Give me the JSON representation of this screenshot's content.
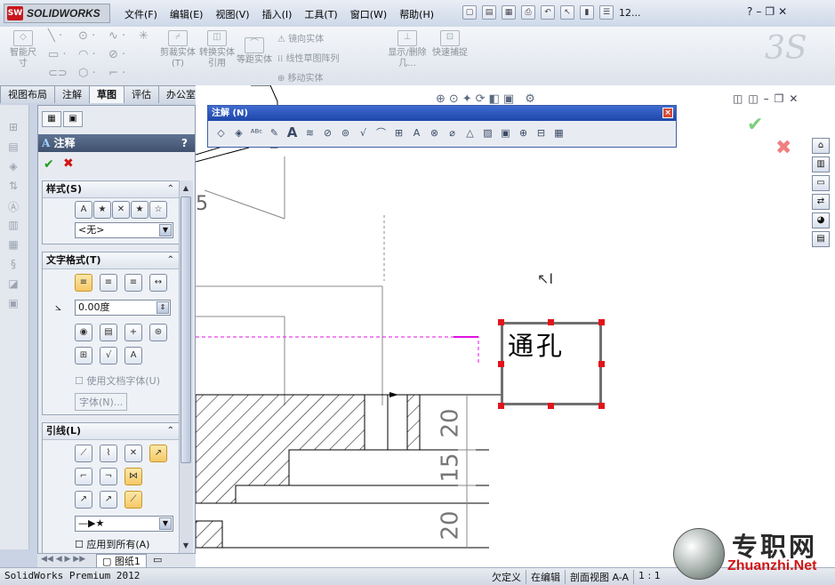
{
  "app": {
    "name": "SOLIDWORKS",
    "logo_mark": "SW",
    "title_suffix": "12...",
    "help": "?"
  },
  "menu": [
    "文件(F)",
    "编辑(E)",
    "视图(V)",
    "插入(I)",
    "工具(T)",
    "窗口(W)",
    "帮助(H)"
  ],
  "command_manager": {
    "smart_dim": "智能尺寸",
    "trim": "剪裁实体(T)",
    "convert": "转换实体引用",
    "offset": "等距实体",
    "mirror": "镜向实体",
    "linear_pattern": "线性草图阵列",
    "move": "移动实体",
    "show_hide": "显示/删除几...",
    "quick_snap": "快速捕捉"
  },
  "tabs": [
    "视图布局",
    "注解",
    "草图",
    "评估",
    "办公室产品"
  ],
  "active_tab": "草图",
  "property_manager": {
    "title": "注释",
    "help": "?",
    "style": {
      "header": "样式(S)",
      "value": "<无>"
    },
    "text_format": {
      "header": "文字格式(T)",
      "angle": "0.00度",
      "use_doc_font": "使用文档字体(U)",
      "font_button": "字体(N)..."
    },
    "leader": {
      "header": "引线(L)",
      "apply_all": "应用到所有(A)"
    }
  },
  "sheet_tab": "图纸1",
  "annotation_toolbar": {
    "title": "注解 (N)",
    "close": "×"
  },
  "note": {
    "text": "通孔"
  },
  "dimensions": [
    "20",
    "15",
    "20"
  ],
  "status": {
    "edition": "SolidWorks Premium 2012",
    "state": "欠定义",
    "editing": "在编辑",
    "view": "剖面视图 A-A",
    "scale": "1 : 1"
  },
  "watermark": {
    "cn": "专职网",
    "en": "Zhuanzhi.Net"
  },
  "colors": {
    "sketch_pink": "#e010e0",
    "handle_red": "#e3131a",
    "accent_blue": "#1e47a8"
  }
}
